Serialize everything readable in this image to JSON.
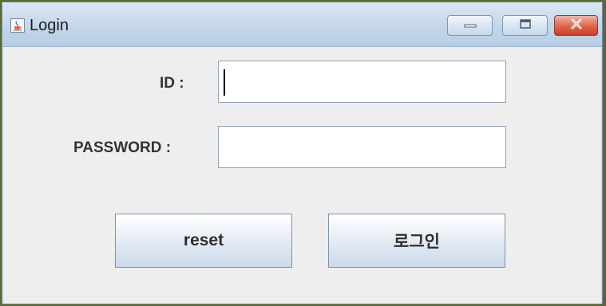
{
  "window": {
    "title": "Login",
    "icon": "java-cup-icon",
    "controls": {
      "minimize_icon": "minimize-icon",
      "maximize_icon": "maximize-icon",
      "close_icon": "close-icon"
    }
  },
  "form": {
    "id_label": "ID :",
    "id_value": "",
    "password_label": "PASSWORD :",
    "password_value": "",
    "reset_label": "reset",
    "login_label": "로그인"
  },
  "colors": {
    "desktop": "#5b6a2a",
    "titlebar": "#c4d6ea",
    "close_button": "#e0634a",
    "client": "#eeeeee"
  }
}
